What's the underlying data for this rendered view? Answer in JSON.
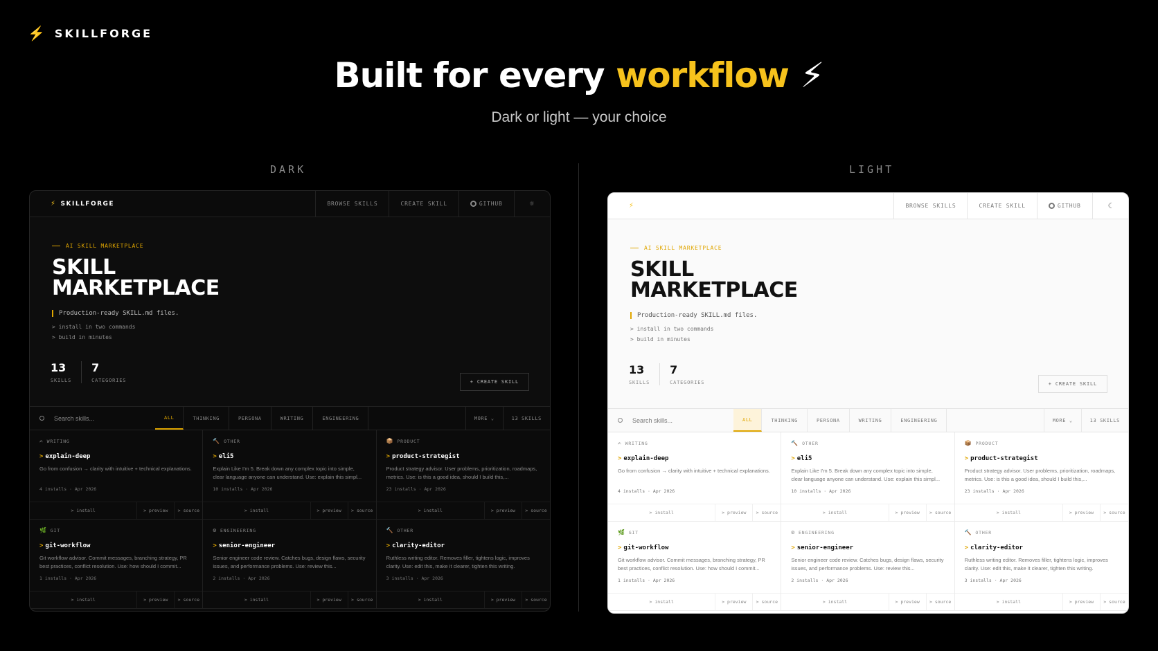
{
  "brand": {
    "icon": "bolt-icon",
    "name": "SKILLFORGE"
  },
  "hero": {
    "title_start": "Built for every",
    "title_highlight": "workflow",
    "title_emoji": "⚡",
    "subtitle": "Dark or light — your choice"
  },
  "labels": {
    "dark": "DARK",
    "light": "LIGHT"
  },
  "app": {
    "logo": "SKILLFORGE",
    "nav": {
      "browse": "BROWSE SKILLS",
      "create": "CREATE SKILL",
      "github": "GITHUB"
    },
    "theme_icon_dark": "sun-icon",
    "theme_icon_light": "moon-icon",
    "eyebrow": "AI SKILL MARKETPLACE",
    "title_line1": "SKILL",
    "title_line2": "MARKETPLACE",
    "tagline": "Production-ready SKILL.md files.",
    "bullet1": "> install in two commands",
    "bullet2": "> build in minutes",
    "stats": [
      {
        "num": "13",
        "label": "SKILLS"
      },
      {
        "num": "7",
        "label": "CATEGORIES"
      }
    ],
    "cta": "+ CREATE SKILL",
    "search_placeholder": "Search skills...",
    "tabs": [
      "ALL",
      "THINKING",
      "PERSONA",
      "WRITING",
      "ENGINEERING"
    ],
    "more": "MORE ⌄",
    "count": "13 SKILLS",
    "actions": {
      "install": "> install",
      "preview": "> preview",
      "source": "> source"
    },
    "cards": [
      {
        "cat_icon": "✍",
        "category": "WRITING",
        "name": "explain-deep",
        "desc": "Go from confusion → clarity with intuitive + technical explanations.",
        "meta": "4 installs · Apr 2026"
      },
      {
        "cat_icon": "🔨",
        "category": "OTHER",
        "name": "eli5",
        "desc": "Explain Like I'm 5. Break down any complex topic into simple, clear language anyone can understand. Use: explain this simpl...",
        "meta": "10 installs · Apr 2026"
      },
      {
        "cat_icon": "📦",
        "category": "PRODUCT",
        "name": "product-strategist",
        "desc": "Product strategy advisor. User problems, prioritization, roadmaps, metrics. Use: is this a good idea, should I build this,...",
        "meta": "23 installs · Apr 2026"
      },
      {
        "cat_icon": "🌿",
        "category": "GIT",
        "name": "git-workflow",
        "desc": "Git workflow advisor. Commit messages, branching strategy, PR best practices, conflict resolution. Use: how should I commit...",
        "meta": "1 installs · Apr 2026"
      },
      {
        "cat_icon": "⚙",
        "category": "ENGINEERING",
        "name": "senior-engineer",
        "desc": "Senior engineer code review. Catches bugs, design flaws, security issues, and performance problems. Use: review this...",
        "meta": "2 installs · Apr 2026"
      },
      {
        "cat_icon": "🔨",
        "category": "OTHER",
        "name": "clarity-editor",
        "desc": "Ruthless writing editor. Removes filler, tightens logic, improves clarity. Use: edit this, make it clearer, tighten this writing.",
        "meta": "3 installs · Apr 2026"
      }
    ]
  },
  "colors": {
    "accent": "#f6c21c",
    "dark_bg": "#0b0b0b",
    "light_bg": "#ffffff"
  }
}
